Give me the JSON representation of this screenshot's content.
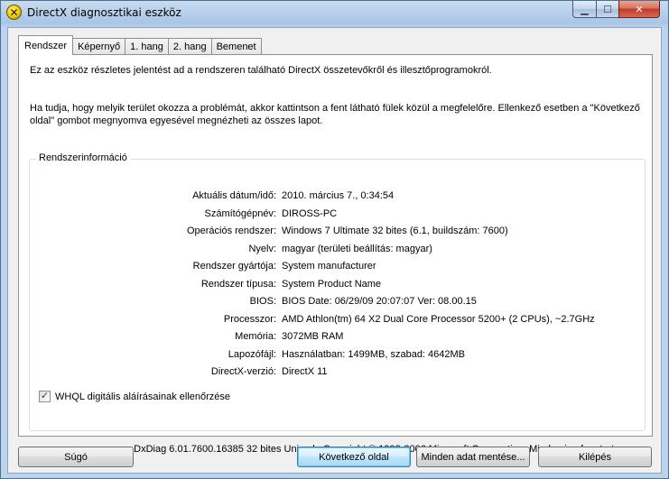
{
  "window": {
    "title": "DirectX diagnosztikai eszköz",
    "icon": "directx-x-icon",
    "controls": {
      "minimize": "minimize-icon",
      "maximize": "maximize-icon",
      "close": "close-icon"
    }
  },
  "tabs": [
    {
      "label": "Rendszer",
      "active": true
    },
    {
      "label": "Képernyő",
      "active": false
    },
    {
      "label": "1. hang",
      "active": false
    },
    {
      "label": "2. hang",
      "active": false
    },
    {
      "label": "Bemenet",
      "active": false
    }
  ],
  "intro": {
    "line1": "Ez az eszköz részletes jelentést ad a rendszeren található DirectX összetevőkről és illesztőprogramokról.",
    "line2": "Ha tudja, hogy melyik terület okozza a problémát, akkor kattintson a fent látható fülek közül a megfelelőre. Ellenkező esetben a \"Következő oldal\" gombot megnyomva egyesével megnézheti az összes lapot."
  },
  "system_info": {
    "title": "Rendszerinformáció",
    "rows": [
      {
        "label": "Aktuális dátum/idő:",
        "value": "2010. március 7., 0:34:54"
      },
      {
        "label": "Számítógépnév:",
        "value": "DIROSS-PC"
      },
      {
        "label": "Operációs rendszer:",
        "value": "Windows 7 Ultimate 32 bites (6.1, buildszám: 7600)"
      },
      {
        "label": "Nyelv:",
        "value": "magyar (területi beállítás: magyar)"
      },
      {
        "label": "Rendszer gyártója:",
        "value": "System manufacturer"
      },
      {
        "label": "Rendszer típusa:",
        "value": "System Product Name"
      },
      {
        "label": "BIOS:",
        "value": "BIOS Date: 06/29/09 20:07:07 Ver: 08.00.15"
      },
      {
        "label": "Processzor:",
        "value": "AMD Athlon(tm) 64 X2 Dual Core Processor 5200+ (2 CPUs), ~2.7GHz"
      },
      {
        "label": "Memória:",
        "value": "3072MB RAM"
      },
      {
        "label": "Lapozófájl:",
        "value": "Használatban: 1499MB, szabad: 4642MB"
      },
      {
        "label": "DirectX-verzió:",
        "value": "DirectX 11"
      }
    ],
    "whql": {
      "label": "WHQL digitális aláírásainak ellenőrzése",
      "checked": true
    }
  },
  "footer": "DxDiag 6.01.7600.16385 32 bites Unicode  Copyright © 1998-2006 Microsoft Corporation. Minden jog fenntartva.",
  "buttons": {
    "help": "Súgó",
    "next": "Következő oldal",
    "save_all": "Minden adat mentése...",
    "exit": "Kilépés"
  }
}
